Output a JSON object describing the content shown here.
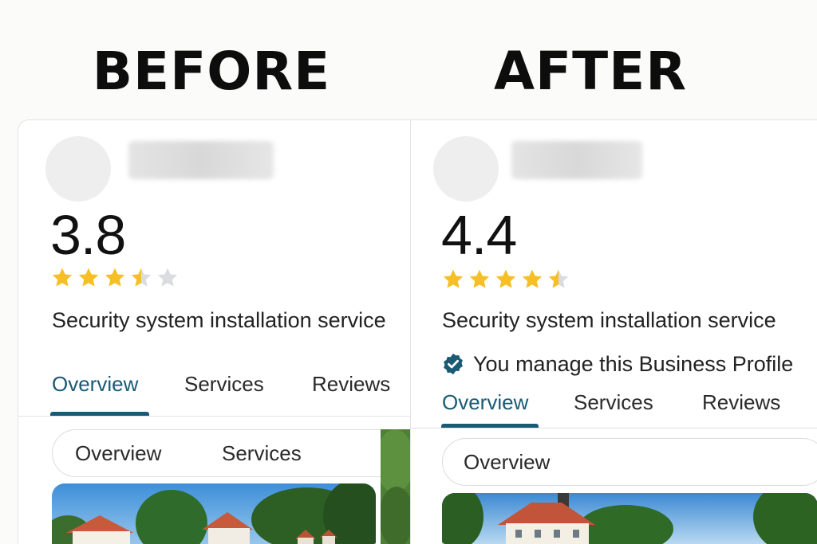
{
  "headings": {
    "before": "BEFORE",
    "after": "AFTER"
  },
  "before": {
    "rating": "3.8",
    "stars_value": 3.5,
    "category": "Security system installation service",
    "tabs": [
      "Overview",
      "Services",
      "Reviews"
    ],
    "active_tab": "Overview",
    "chips": [
      "Overview",
      "Services"
    ]
  },
  "after": {
    "rating": "4.4",
    "stars_value": 4.5,
    "category": "Security system installation service",
    "verified_text": "You manage this Business Profile",
    "tabs": [
      "Overview",
      "Services",
      "Reviews"
    ],
    "active_tab": "Overview",
    "chips": [
      "Overview"
    ]
  },
  "colors": {
    "star": "#f6bf26",
    "star_empty": "#dadce0",
    "accent": "#1a5a75",
    "verified_badge": "#1a5a75"
  },
  "icons": [
    "star-icon",
    "verified-badge-icon"
  ]
}
